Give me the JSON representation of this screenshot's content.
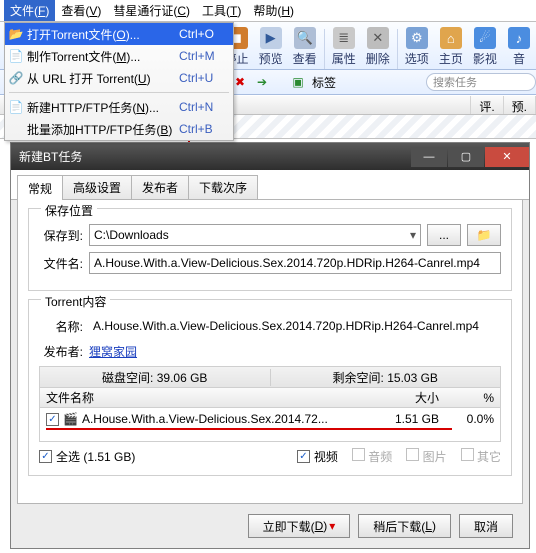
{
  "menubar": {
    "items": [
      {
        "label": "文件(",
        "acc": "F",
        "tail": ")"
      },
      {
        "label": "查看(",
        "acc": "V",
        "tail": ")"
      },
      {
        "label": "彗星通行证(",
        "acc": "C",
        "tail": ")"
      },
      {
        "label": "工具(",
        "acc": "T",
        "tail": ")"
      },
      {
        "label": "帮助(",
        "acc": "H",
        "tail": ")"
      }
    ]
  },
  "file_menu": {
    "items": [
      {
        "label": "打开Torrent文件(",
        "acc": "O",
        "tail": ")...",
        "shortcut": "Ctrl+O",
        "icon": "folder",
        "hl": true
      },
      {
        "label": "制作Torrent文件(",
        "acc": "M",
        "tail": ")...",
        "shortcut": "Ctrl+M",
        "icon": "make"
      },
      {
        "label": "从 URL 打开  Torrent(",
        "acc": "U",
        "tail": ")",
        "shortcut": "Ctrl+U",
        "icon": "url"
      },
      {
        "sep": true
      },
      {
        "label": "新建HTTP/FTP任务(",
        "acc": "N",
        "tail": ")...",
        "shortcut": "Ctrl+N",
        "icon": "new"
      },
      {
        "label": "批量添加HTTP/FTP任务(",
        "acc": "B",
        "tail": ")",
        "shortcut": "Ctrl+B",
        "icon": ""
      }
    ]
  },
  "toolbar": {
    "items": [
      {
        "name": "stop",
        "label": "停止",
        "gly": "◼",
        "bg": "#d07c2d"
      },
      {
        "name": "preview",
        "label": "预览",
        "gly": "▶",
        "bg": "#bfcfe6"
      },
      {
        "name": "find",
        "label": "查看",
        "gly": "🔍",
        "bg": "#aebed6"
      },
      {
        "sep": true
      },
      {
        "name": "props",
        "label": "属性",
        "gly": "≣",
        "bg": "#c9c9c9"
      },
      {
        "name": "delete",
        "label": "删除",
        "gly": "✕",
        "bg": "#bdbdbd"
      },
      {
        "sep": true
      },
      {
        "name": "options",
        "label": "选项",
        "gly": "⚙",
        "bg": "#7aa2d6"
      },
      {
        "name": "home",
        "label": "主页",
        "gly": "⌂",
        "bg": "#e0a54d"
      },
      {
        "name": "media",
        "label": "影视",
        "gly": "☄",
        "bg": "#4b8de0"
      },
      {
        "name": "music",
        "label": "音",
        "gly": "♪",
        "bg": "#4b8de0"
      }
    ]
  },
  "addr": {
    "label1": "标签",
    "search_placeholder": "搜索任务"
  },
  "listhdr": {
    "c1": "评.",
    "c2": "预."
  },
  "dialog": {
    "title": "新建BT任务",
    "tabs": [
      {
        "label": "常规",
        "active": true
      },
      {
        "label": "高级设置"
      },
      {
        "label": "发布者"
      },
      {
        "label": "下载次序"
      }
    ],
    "save": {
      "group": "保存位置",
      "save_to_label": "保存到:",
      "save_to_value": "C:\\Downloads",
      "filename_label": "文件名:",
      "filename_value": "A.House.With.a.View-Delicious.Sex.2014.720p.HDRip.H264-Canrel.mp4"
    },
    "torrent": {
      "group": "Torrent内容",
      "name_label": "名称:",
      "name_value": "A.House.With.a.View-Delicious.Sex.2014.720p.HDRip.H264-Canrel.mp4",
      "pub_label": "发布者:",
      "pub_value": "狸窝家园",
      "disk_total_label": "磁盘空间:",
      "disk_total": "39.06 GB",
      "disk_free_label": "剩余空间:",
      "disk_free": "15.03 GB",
      "col_name": "文件名称",
      "col_size": "大小",
      "col_pct": "%",
      "file": {
        "name": "A.House.With.a.View-Delicious.Sex.2014.72...",
        "size": "1.51 GB",
        "pct": "0.0%"
      },
      "select_all": "全选 (1.51 GB)",
      "filters": [
        {
          "label": "视频",
          "checked": true,
          "disabled": false
        },
        {
          "label": "音频",
          "checked": false,
          "disabled": true
        },
        {
          "label": "图片",
          "checked": false,
          "disabled": true
        },
        {
          "label": "其它",
          "checked": false,
          "disabled": true
        }
      ]
    },
    "buttons": {
      "now": "立即下载(",
      "now_acc": "D",
      "tail": ")",
      "later": "稍后下载(",
      "later_acc": "L",
      "cancel": "取消"
    }
  }
}
